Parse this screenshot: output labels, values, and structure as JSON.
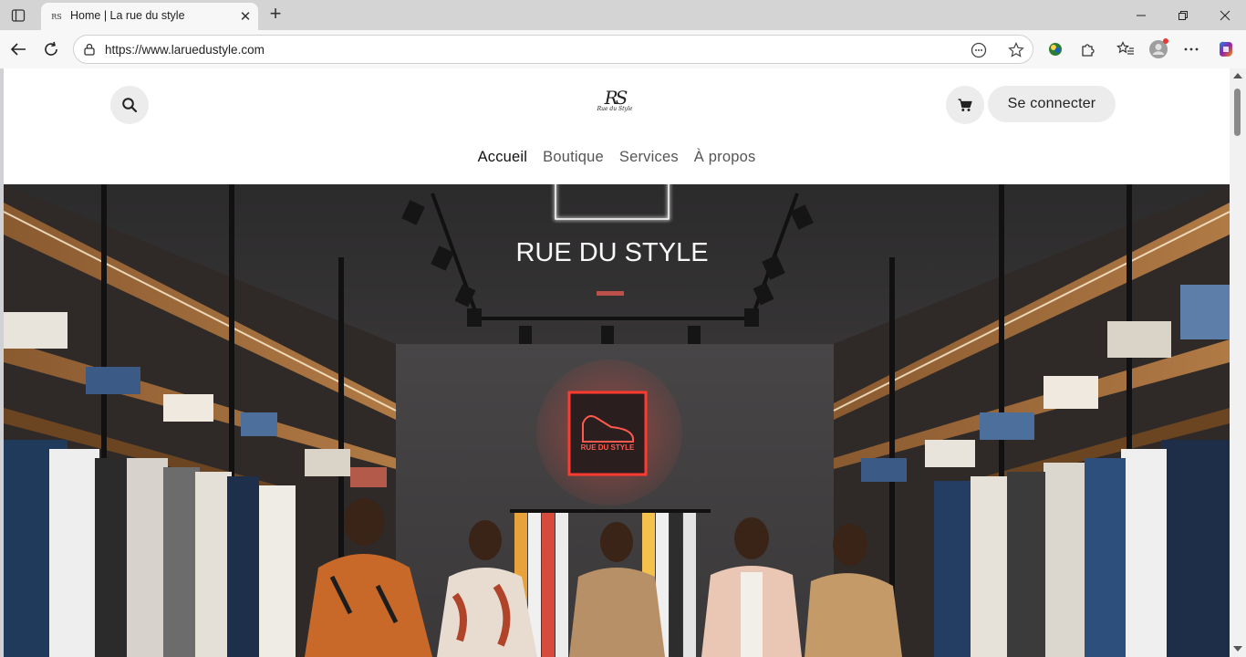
{
  "browser": {
    "tab": {
      "title": "Home | La rue du style",
      "favicon": "rs-logo-icon"
    },
    "address": {
      "url": "https://www.laruedustyle.com"
    },
    "icons": [
      "tab-actions-icon",
      "close-icon",
      "new-tab-icon",
      "minimize-icon",
      "restore-icon",
      "window-close-icon",
      "back-icon",
      "refresh-icon",
      "site-info-icon",
      "reader-mode-icon",
      "favorite-star-icon",
      "extension-icon",
      "puzzle-icon",
      "favorites-icon",
      "profile-avatar-icon",
      "more-icon",
      "copilot-icon"
    ]
  },
  "site": {
    "logo": {
      "monogram": "RS",
      "tagline": "Rue du Style"
    },
    "login_label": "Se connecter",
    "nav": [
      {
        "label": "Accueil",
        "active": true
      },
      {
        "label": "Boutique",
        "active": false
      },
      {
        "label": "Services",
        "active": false
      },
      {
        "label": "À propos",
        "active": false
      }
    ],
    "hero": {
      "ceiling_sign": "RUE DU STYLE",
      "neon_sign": "RUE DU STYLE",
      "neon_color": "#ff3b30"
    }
  }
}
